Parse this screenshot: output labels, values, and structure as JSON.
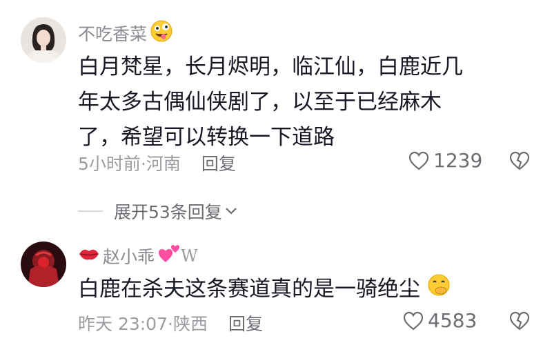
{
  "comments": [
    {
      "username": "不吃香菜",
      "content_lines": [
        "白月梵星，长月烬明，临江仙，白鹿近几",
        "年太多古偶仙侠剧了，以至于已经麻木",
        "了，希望可以转换一下道路"
      ],
      "time_location": "5小时前·河南",
      "reply_label": "回复",
      "likes": "1239",
      "name_emoji": "zany-face",
      "expand_label": "展开53条回复"
    },
    {
      "username": "赵小乖",
      "name_suffix": "W",
      "content": "白鹿在杀夫这条赛道真的是一骑绝尘",
      "time_location": "昨天 23:07·陕西",
      "reply_label": "回复",
      "likes": "4583",
      "name_emoji_prefix": "lips",
      "name_emoji_suffix": "two-hearts",
      "content_emoji": "hand-over-mouth-face"
    }
  ],
  "colors": {
    "text": "#161823",
    "secondary": "#8a8b91",
    "muted": "#9b9ca1"
  }
}
